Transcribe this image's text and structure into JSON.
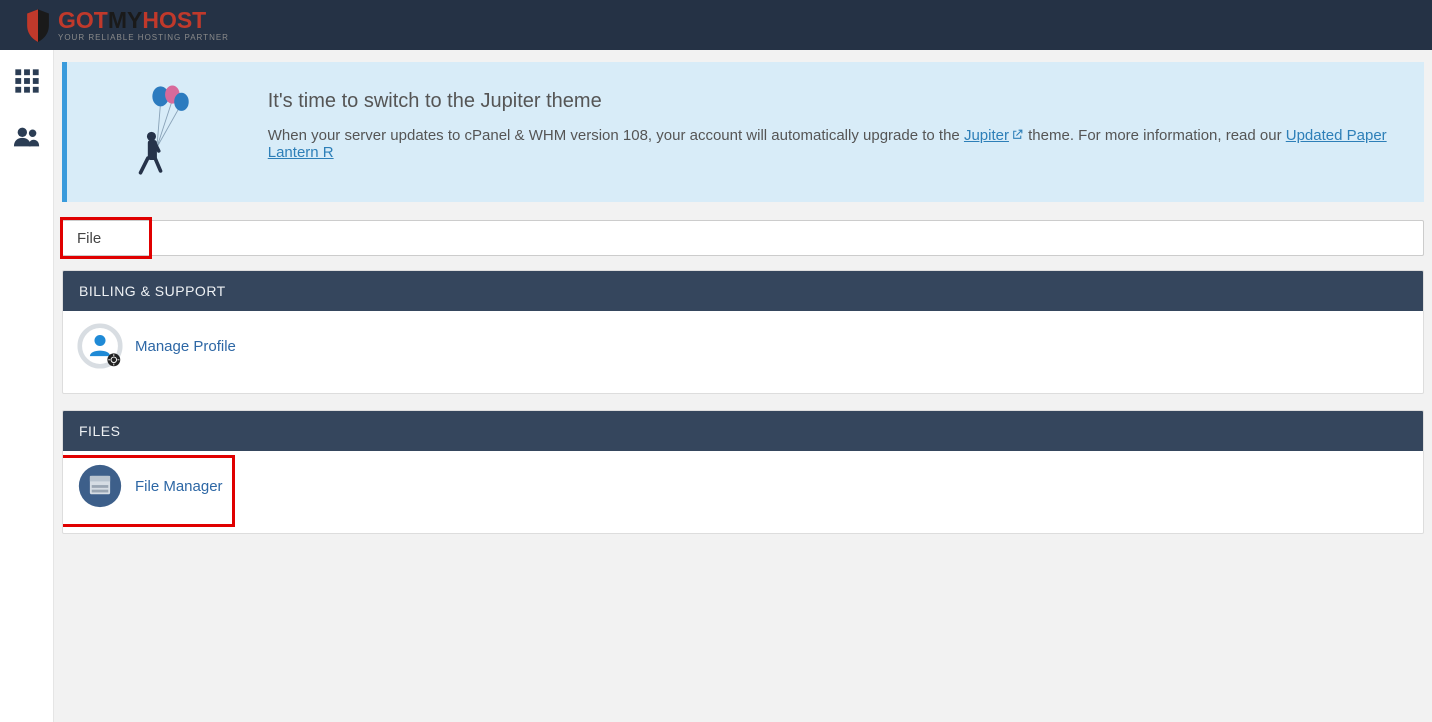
{
  "brand": {
    "name_part1": "GOT",
    "name_part2": "MY",
    "name_part3": "HOST",
    "tagline": "YOUR RELIABLE HOSTING PARTNER"
  },
  "banner": {
    "title": "It's time to switch to the Jupiter theme",
    "body_pre": "When your server updates to cPanel & WHM version 108, your account will automatically upgrade to the ",
    "link1": "Jupiter",
    "body_mid": " theme. For more information, read our ",
    "link2": "Updated Paper Lantern R"
  },
  "search": {
    "value": "File"
  },
  "sections": {
    "billing": {
      "title": "BILLING & SUPPORT",
      "items": [
        {
          "label": "Manage Profile"
        }
      ]
    },
    "files": {
      "title": "FILES",
      "items": [
        {
          "label": "File Manager"
        }
      ]
    }
  }
}
